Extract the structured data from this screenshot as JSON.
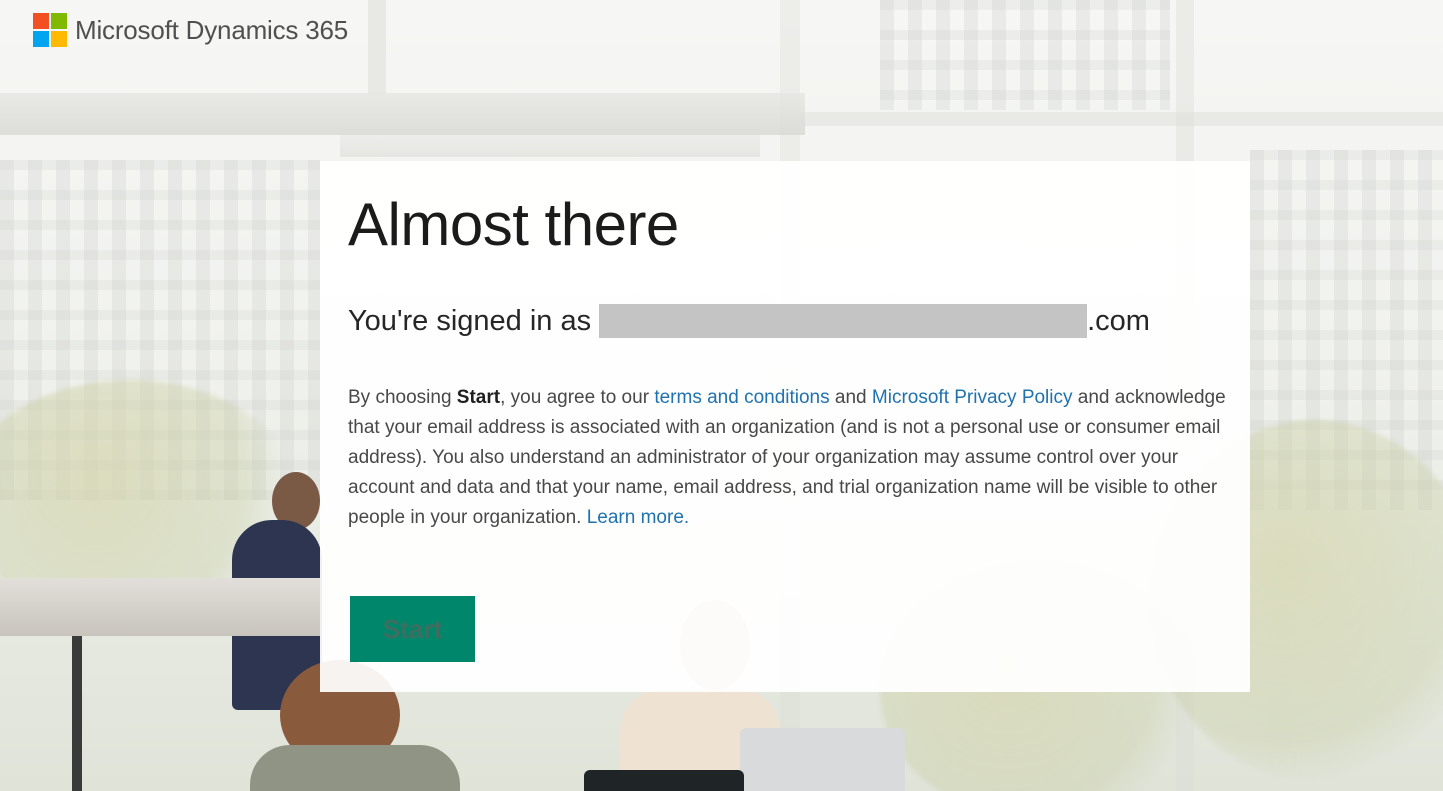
{
  "brand": {
    "title": "Microsoft Dynamics 365",
    "logo_colors": [
      "#f25022",
      "#7fba00",
      "#00a4ef",
      "#ffb900"
    ]
  },
  "card": {
    "title": "Almost there",
    "signed_in_prefix": "You're signed in as",
    "signed_in_suffix": ".com",
    "agreement": {
      "part1": "By choosing ",
      "start_word": "Start",
      "part2": ", you agree to our ",
      "terms_link": "terms and conditions",
      "part3": " and ",
      "privacy_link": "Microsoft Privacy Policy",
      "part4": " and acknowledge that your email address is associated with an organization (and is not a personal use or consumer email address). You also understand an administrator of your organization may assume control over your account and data and that your name, email address, and trial organization name will be visible to other people in your organization. ",
      "learn_more_link": "Learn more."
    },
    "start_button_label": "Start"
  },
  "colors": {
    "accent": "#00876b",
    "link": "#1f72ae"
  }
}
